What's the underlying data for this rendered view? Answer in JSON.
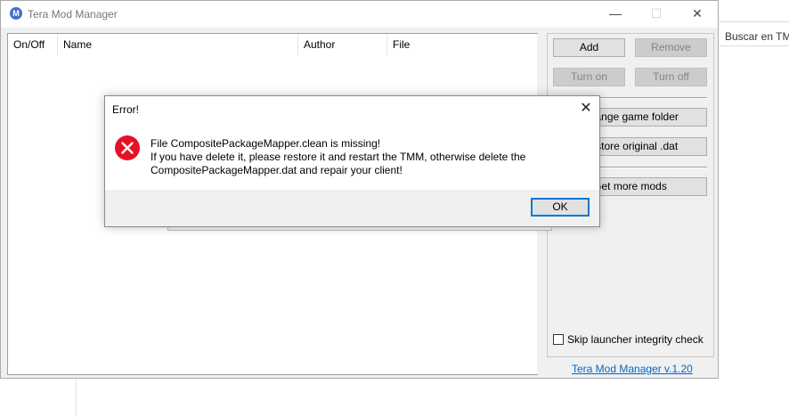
{
  "window": {
    "title": "Tera Mod Manager",
    "app_icon_glyph": "M",
    "controls": {
      "minimize": "—",
      "maximize": "☐",
      "close": "✕"
    }
  },
  "background": {
    "search_placeholder": "Buscar en TM"
  },
  "mod_list": {
    "columns": [
      "On/Off",
      "Name",
      "Author",
      "File"
    ],
    "rows": []
  },
  "actions": {
    "add": "Add",
    "remove": "Remove",
    "turn_on": "Turn on",
    "turn_off": "Turn off",
    "change_game_folder": "Change game folder",
    "restore_original_dat": "Restore original .dat",
    "get_more_mods": "Get more mods"
  },
  "options": {
    "skip_launcher_integrity_check": "Skip launcher integrity check",
    "skip_checked": false
  },
  "footer": {
    "version_link": "Tera Mod Manager v.1.20"
  },
  "dialog": {
    "title": "Error!",
    "close": "✕",
    "message_lines": [
      "File CompositePackageMapper.clean is missing!",
      "If you have delete it, please restore it and restart the TMM, otherwise delete the",
      "CompositePackageMapper.dat and repair your client!"
    ],
    "ok": "OK"
  },
  "colors": {
    "accent": "#0078d7",
    "error": "#e81123",
    "link": "#0066cc"
  }
}
